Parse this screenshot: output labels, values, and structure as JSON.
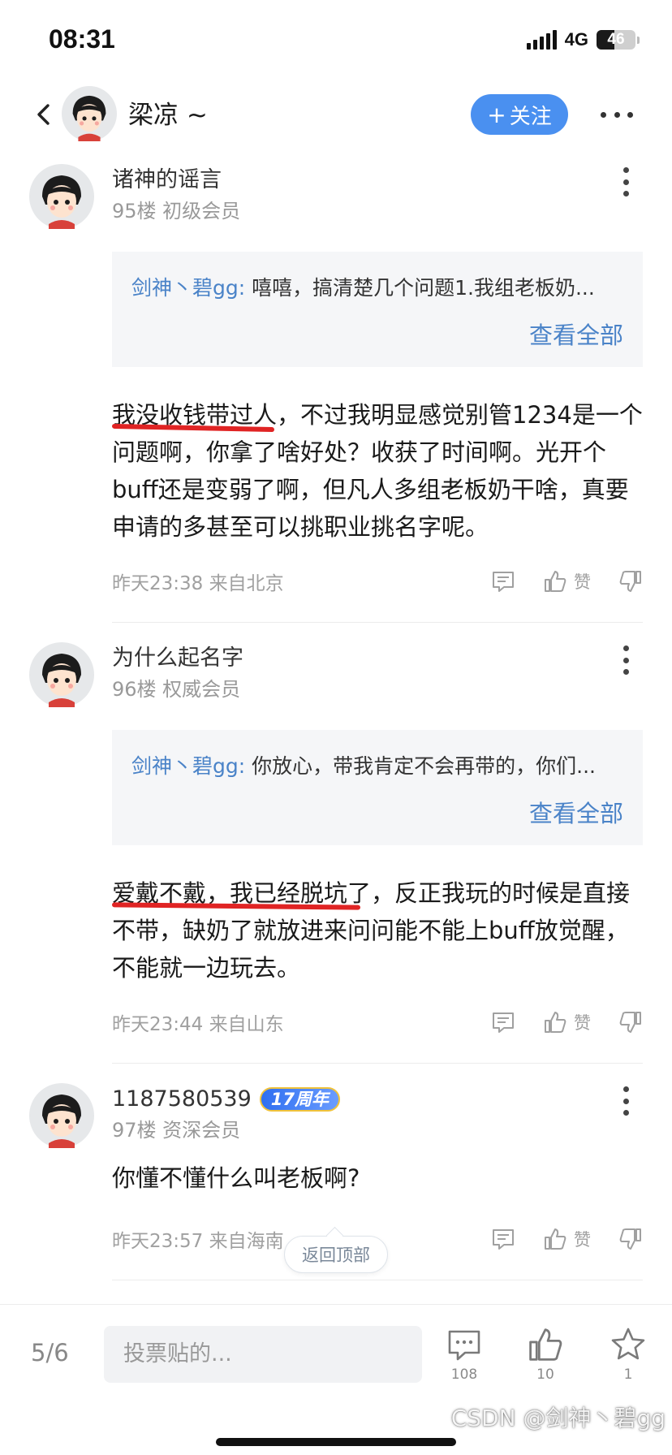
{
  "status_bar": {
    "time": "08:31",
    "network": "4G",
    "battery": "46",
    "battery_level": 0.46
  },
  "header": {
    "user_name": "梁凉 ~",
    "follow_label": "关注"
  },
  "posts": [
    {
      "user": "诸神的谣言",
      "meta": "95楼 初级会员",
      "quote_author": "剑神丶碧gg:",
      "quote_text": "嘻嘻，搞清楚几个问题1.我组老板奶...",
      "view_all": "查看全部",
      "body_line1_marked": "我没收钱带过人",
      "body_rest": "，不过我明显感觉别管1234是一个问题啊，你拿了啥好处？收获了时间啊。光开个buff还是变弱了啊，但凡人多组老板奶干啥，真要申请的多甚至可以挑职业挑名字呢。",
      "time": "昨天23:38 来自北京",
      "like": "赞"
    },
    {
      "user": "为什么起名字",
      "meta": "96楼 权威会员",
      "quote_author": "剑神丶碧gg:",
      "quote_text": "你放心，带我肯定不会再带的，你们...",
      "view_all": "查看全部",
      "body_line1_marked": "爱戴不戴，我已经脱坑了",
      "body_rest": "，反正我玩的时候是直接不带，缺奶了就放进来问问能不能上buff放觉醒，不能就一边玩去。",
      "time": "昨天23:44 来自山东",
      "like": "赞"
    },
    {
      "user": "1187580539",
      "badge": "17周年",
      "meta": "97楼 资深会员",
      "body": "你懂不懂什么叫老板啊?",
      "time": "昨天23:57 来自海南",
      "like": "赞"
    }
  ],
  "back_to_top": "返回顶部",
  "bottom_bar": {
    "page": "5/6",
    "input_placeholder": "投票贴的...",
    "comments_count": "108",
    "likes_count": "10",
    "favorites_count": "1"
  },
  "watermark": "CSDN @剑神丶碧gg"
}
